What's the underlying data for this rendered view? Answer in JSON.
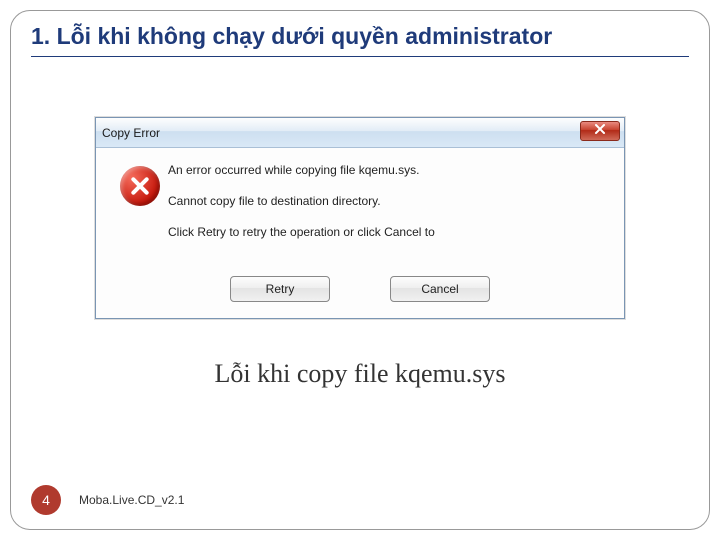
{
  "heading": "1. Lỗi khi không chạy dưới quyền administrator",
  "dialog": {
    "title": "Copy Error",
    "messages": [
      "An error occurred while copying file kqemu.sys.",
      "Cannot copy file to destination directory.",
      "Click Retry to retry the operation or click Cancel to"
    ],
    "retry_label": "Retry",
    "cancel_label": "Cancel"
  },
  "caption": "Lỗi khi copy file kqemu.sys",
  "page_number": "4",
  "footer_text": "Moba.Live.CD_v2.1"
}
